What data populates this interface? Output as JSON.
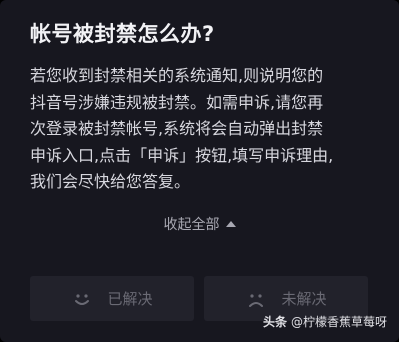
{
  "faq": {
    "title": "帐号被封禁怎么办?",
    "answer_lines": [
      "若您收到封禁相关的系统通知,则说明您的",
      "抖音号涉嫌违规被封禁。如需申诉,请您再",
      "次登录被封禁帐号,系统将会自动弹出封禁",
      "申诉入口,点击「申诉」按钮,填写申诉理由,",
      "我们会尽快给您答复。"
    ],
    "collapse_label": "收起全部",
    "collapse_icon": "caret-up-icon"
  },
  "feedback": {
    "solved_label": "已解决",
    "solved_icon": "smile-face-icon",
    "unsolved_label": "未解决",
    "unsolved_icon": "frown-face-icon"
  },
  "watermark": {
    "brand": "头条",
    "handle": "@柠檬香蕉草莓呀"
  },
  "colors": {
    "background": "#17171f",
    "button_bg": "#22222b",
    "muted_text": "#6a6a74"
  }
}
